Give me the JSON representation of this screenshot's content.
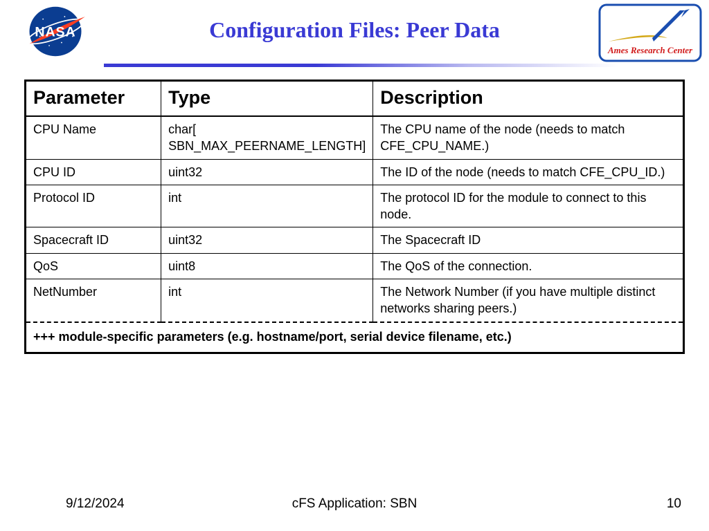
{
  "title": "Configuration Files: Peer Data",
  "logos": {
    "left": "nasa-logo",
    "right": "ames-research-center-logo",
    "right_text": "Ames Research Center"
  },
  "table": {
    "headers": [
      "Parameter",
      "Type",
      "Description"
    ],
    "rows": [
      {
        "param": "CPU Name",
        "type": "char[\nSBN_MAX_PEERNAME_LENGTH]",
        "desc": "The CPU name of the node (needs to match CFE_CPU_NAME.)"
      },
      {
        "param": "CPU ID",
        "type": "uint32",
        "desc": "The ID of the node (needs to match CFE_CPU_ID.)"
      },
      {
        "param": "Protocol ID",
        "type": "int",
        "desc": "The protocol ID for the module to connect to this node."
      },
      {
        "param": "Spacecraft ID",
        "type": "uint32",
        "desc": "The Spacecraft ID"
      },
      {
        "param": "QoS",
        "type": "uint8",
        "desc": "The QoS of the connection."
      },
      {
        "param": "NetNumber",
        "type": "int",
        "desc": "The Network Number (if you have multiple distinct networks sharing peers.)"
      }
    ],
    "footnote": "+++ module-specific parameters (e.g. hostname/port, serial device filename, etc.)"
  },
  "footer": {
    "date": "9/12/2024",
    "title": "cFS Application: SBN",
    "page": "10"
  },
  "colors": {
    "title_color": "#3a3ad4",
    "nasa_blue": "#0b3d91",
    "nasa_red": "#fc3d21",
    "ames_border": "#1a4eb0",
    "ames_red": "#d11b1b",
    "ames_gold": "#d4a91a"
  }
}
